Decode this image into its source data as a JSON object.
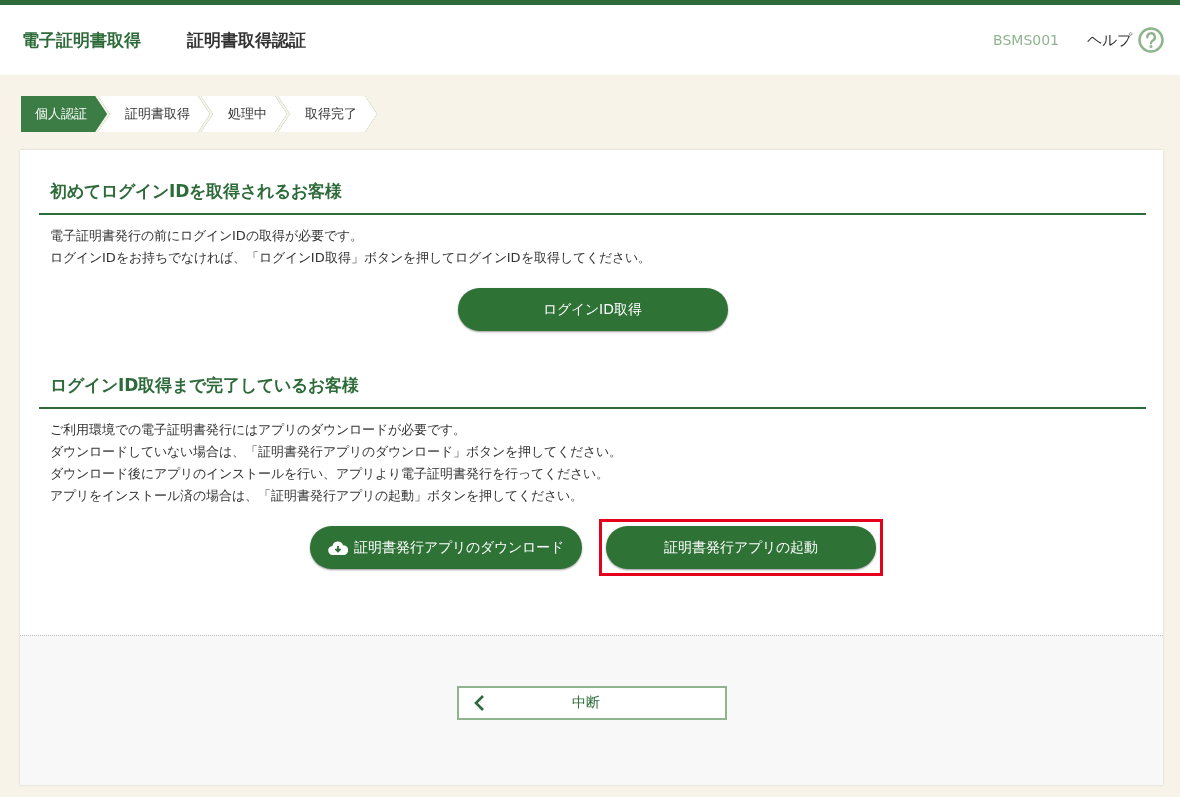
{
  "header": {
    "title": "電子証明書取得",
    "subtitle": "証明書取得認証",
    "screen_code": "BSMS001",
    "help": "ヘルプ"
  },
  "steps": [
    {
      "label": "個人認証",
      "selected": true
    },
    {
      "label": "証明書取得",
      "selected": false
    },
    {
      "label": "処理中",
      "selected": false
    },
    {
      "label": "取得完了",
      "selected": false
    }
  ],
  "sections": [
    {
      "heading": "初めてログインIDを取得されるお客様",
      "lines": [
        "電子証明書発行の前にログインIDの取得が必要です。",
        "ログインIDをお持ちでなければ、「ログインID取得」ボタンを押してログインIDを取得してください。"
      ],
      "buttons": [
        {
          "label": "ログインID取得",
          "kind": "plain",
          "highlighted": false
        }
      ]
    },
    {
      "heading": "ログインID取得まで完了しているお客様",
      "lines": [
        "ご利用環境での電子証明書発行にはアプリのダウンロードが必要です。",
        "ダウンロードしていない場合は、「証明書発行アプリのダウンロード」ボタンを押してください。",
        "ダウンロード後にアプリのインストールを行い、アプリより電子証明書発行を行ってください。",
        "アプリをインストール済の場合は、「証明書発行アプリの起動」ボタンを押してください。"
      ],
      "buttons": [
        {
          "label": "証明書発行アプリのダウンロード",
          "kind": "download",
          "highlighted": false
        },
        {
          "label": "証明書発行アプリの起動",
          "kind": "plain",
          "highlighted": true
        }
      ]
    }
  ],
  "footer": {
    "cancel": "中断"
  }
}
